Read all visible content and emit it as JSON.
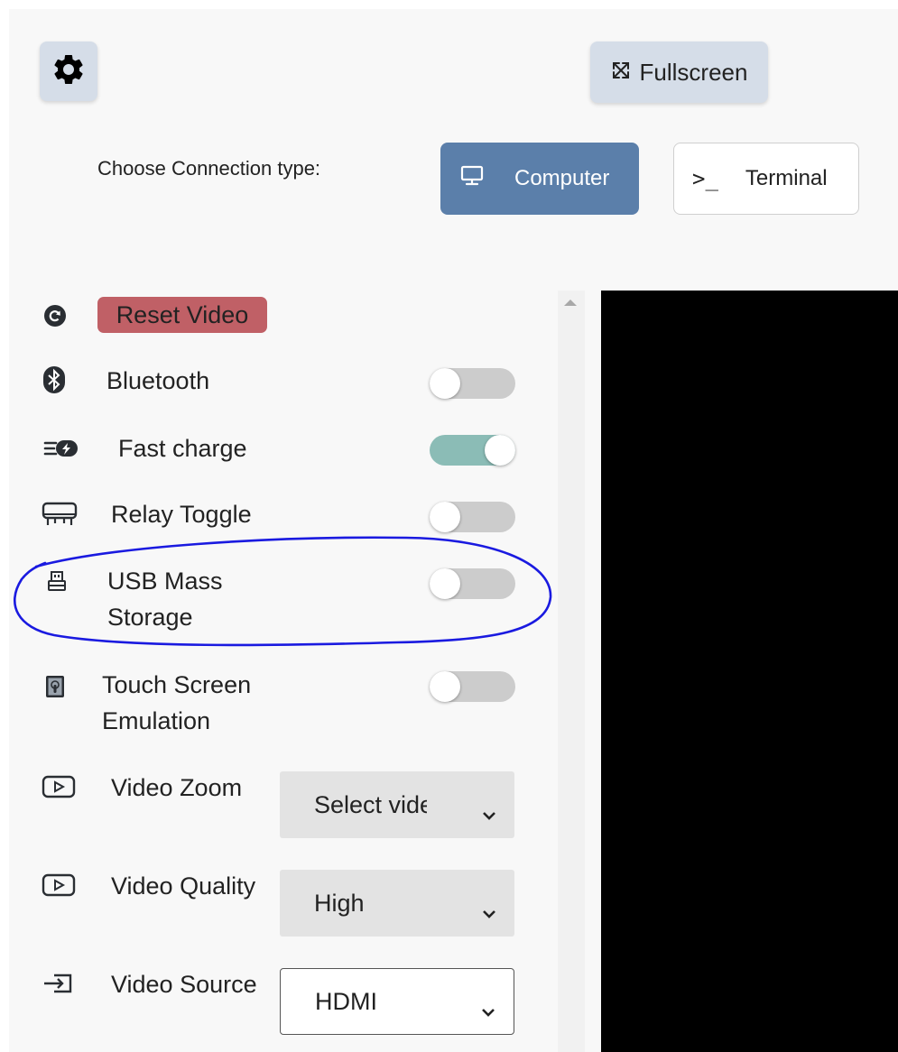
{
  "toolbar": {
    "settings_icon": "gear-icon",
    "fullscreen_label": "Fullscreen",
    "fullscreen_icon": "expand-arrows-icon"
  },
  "connection": {
    "label": "Choose Connection type:",
    "options": [
      {
        "label": "Computer",
        "icon": "monitor-icon",
        "selected": true
      },
      {
        "label": "Terminal",
        "icon": "terminal-prompt-icon",
        "prompt": ">_",
        "selected": false
      }
    ]
  },
  "sidebar": {
    "reset_video": {
      "label": "Reset Video",
      "icon": "refresh-icon"
    },
    "toggles": [
      {
        "label": "Bluetooth",
        "icon": "bluetooth-icon",
        "on": false
      },
      {
        "label": "Fast charge",
        "icon": "fast-charge-icon",
        "on": true
      },
      {
        "label": "Relay Toggle",
        "icon": "relay-icon",
        "on": false
      },
      {
        "label_line1": "USB Mass",
        "label_line2": "Storage",
        "icon": "usb-drive-icon",
        "on": false
      },
      {
        "label_line1": "Touch Screen",
        "label_line2": "Emulation",
        "icon": "touch-screen-icon",
        "on": false
      }
    ],
    "selects": [
      {
        "label": "Video Zoom",
        "icon": "play-icon",
        "value": "Select video zoom"
      },
      {
        "label": "Video Quality",
        "icon": "play-icon",
        "value": "High"
      },
      {
        "label": "Video Source",
        "icon": "input-source-icon",
        "value": "HDMI"
      }
    ]
  },
  "colors": {
    "primary": "#5b7faa",
    "danger": "#c06066",
    "toggle_on": "#8bbcb6",
    "annotation": "#1a1ae0"
  }
}
